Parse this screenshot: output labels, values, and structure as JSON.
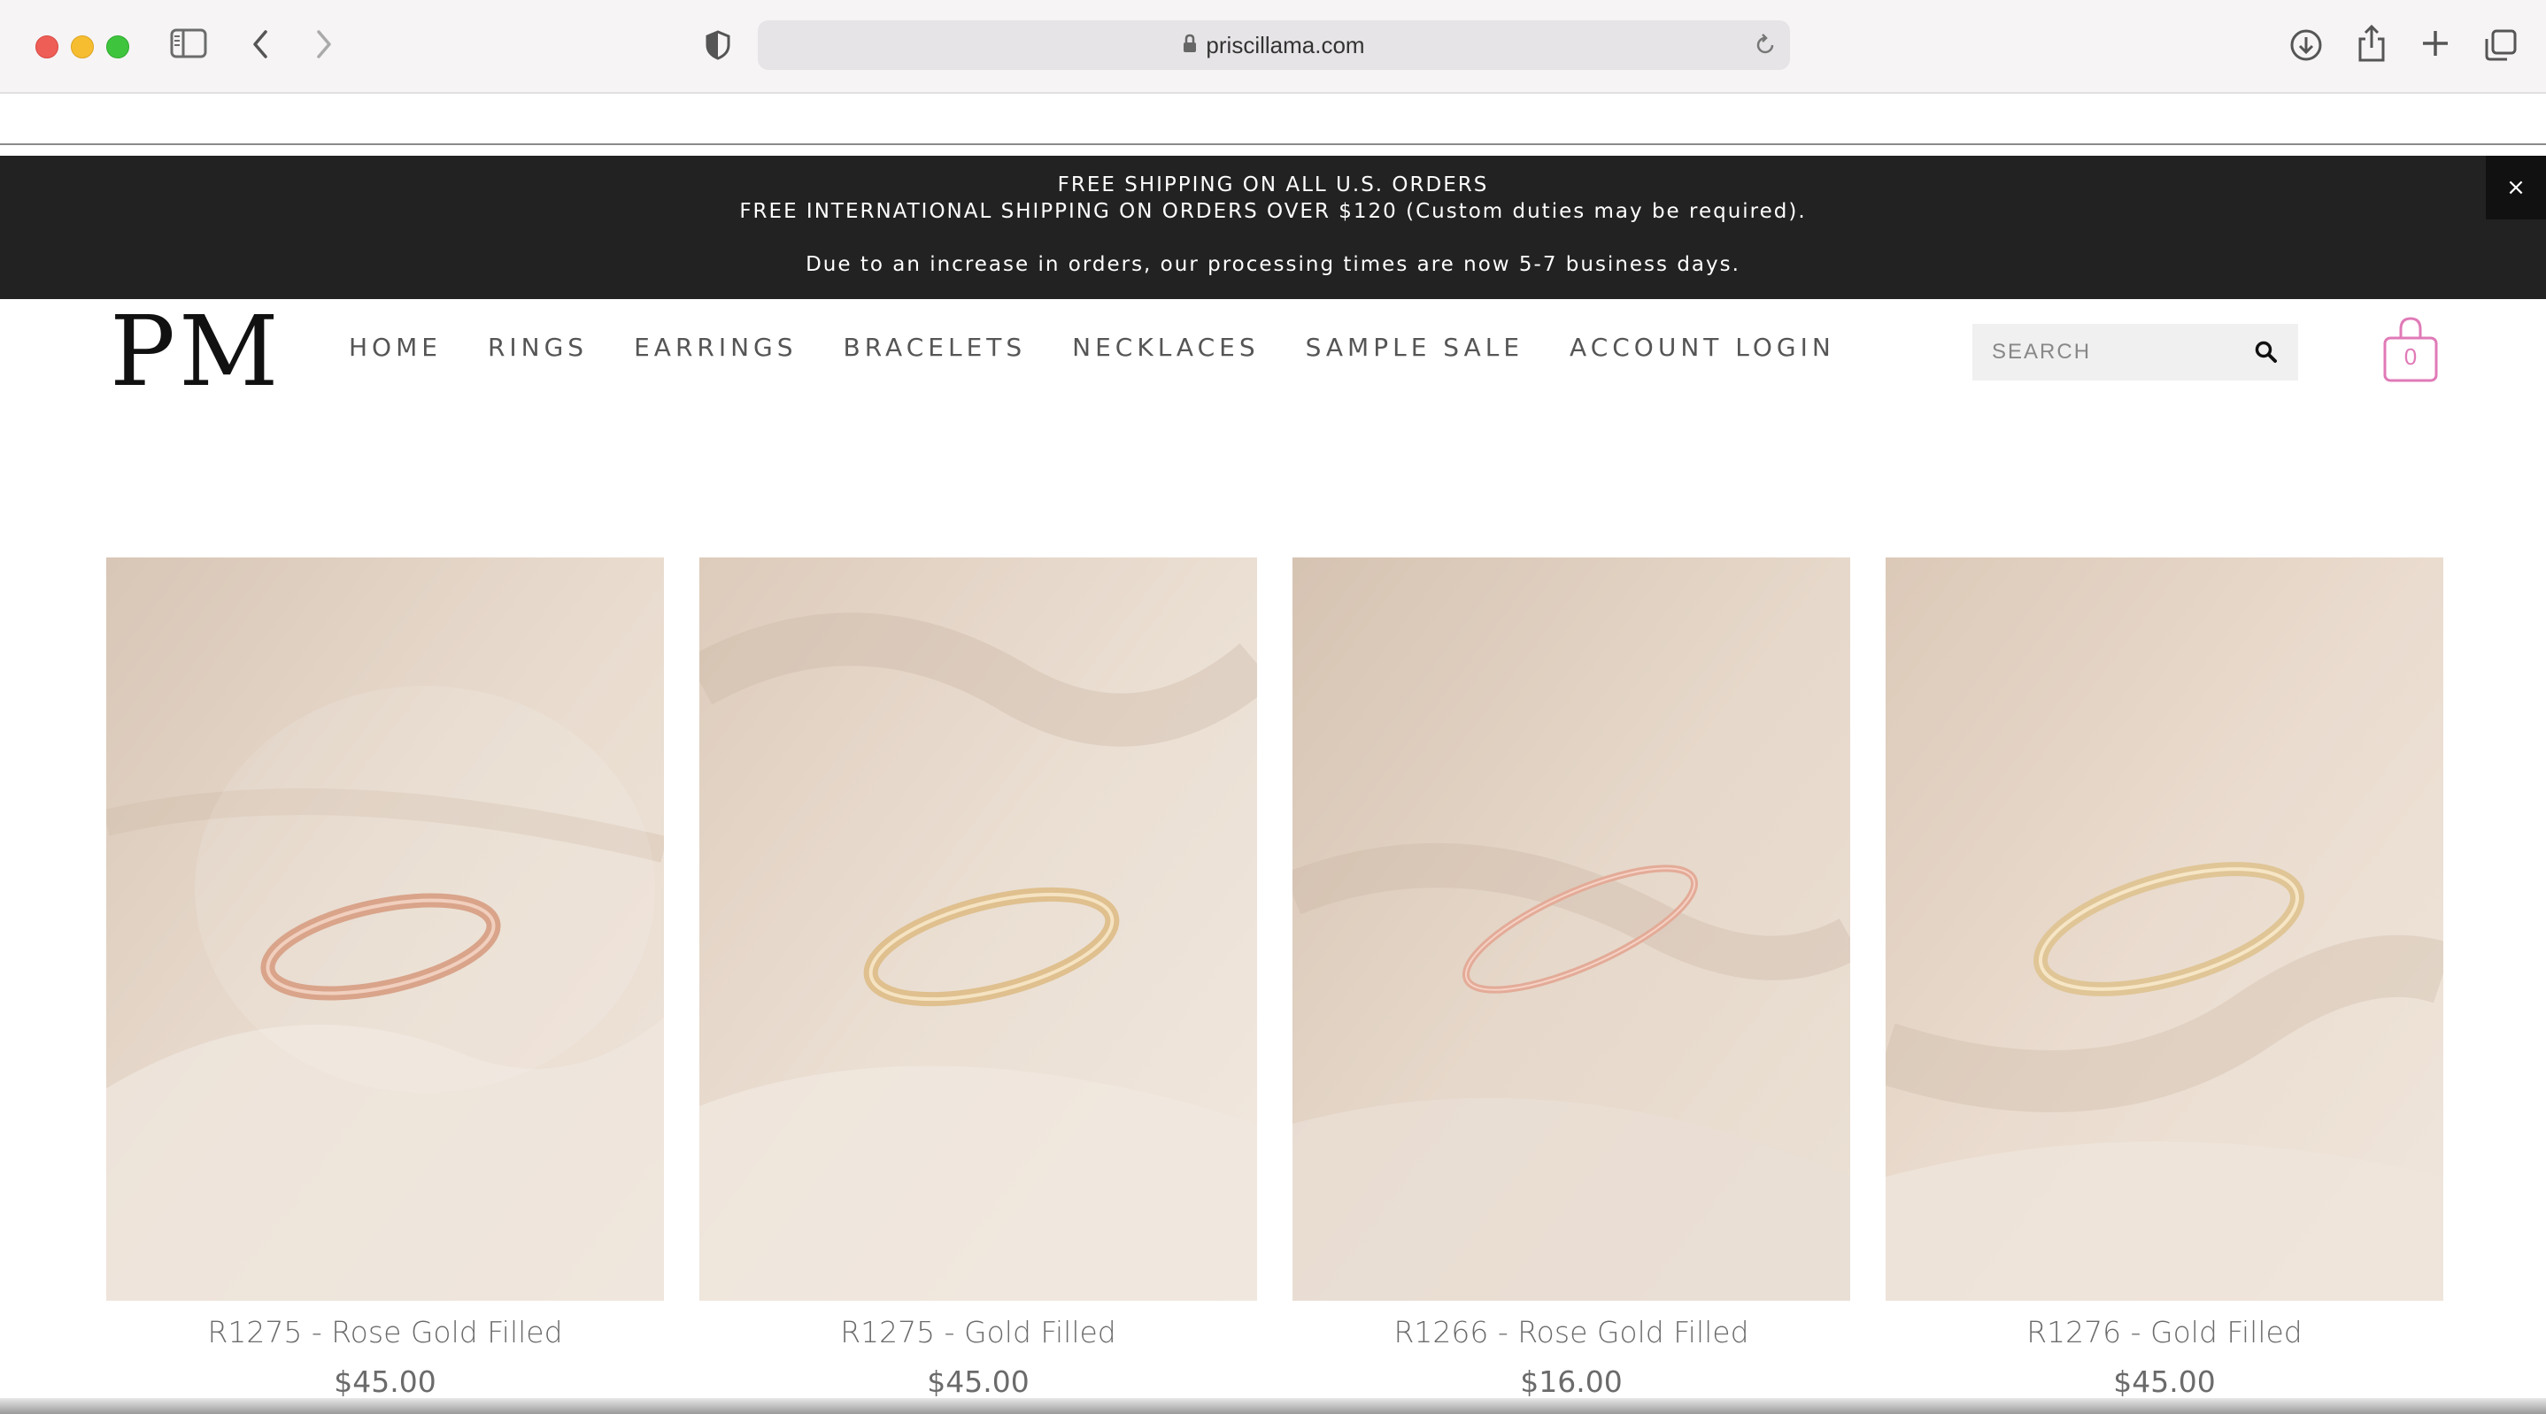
{
  "browser": {
    "url": "priscillama.com"
  },
  "announcement": {
    "line1": "FREE SHIPPING ON ALL U.S. ORDERS",
    "line2": "FREE INTERNATIONAL SHIPPING ON ORDERS OVER $120 (Custom duties may be required).",
    "line3": "Due to an increase in orders, our processing times are now 5-7 business days.",
    "close": "×"
  },
  "header": {
    "logo": "PM",
    "nav": [
      "HOME",
      "RINGS",
      "EARRINGS",
      "BRACELETS",
      "NECKLACES",
      "SAMPLE SALE",
      "ACCOUNT LOGIN"
    ],
    "search_placeholder": "SEARCH",
    "cart_count": "0"
  },
  "products": [
    {
      "name": "R1275 - Rose Gold Filled",
      "price": "$45.00",
      "ring_color": "#d9a48a"
    },
    {
      "name": "R1275 - Gold Filled",
      "price": "$45.00",
      "ring_color": "#dfc08e"
    },
    {
      "name": "R1266 - Rose Gold Filled",
      "price": "$16.00",
      "ring_color": "#e3ab98"
    },
    {
      "name": "R1276 - Gold Filled",
      "price": "$45.00",
      "ring_color": "#e0c596"
    }
  ],
  "colors": {
    "announcement_bg": "#222222",
    "cart_accent": "#e07ab7",
    "nav_text": "#555555",
    "fabric": "#e6d8cc"
  }
}
